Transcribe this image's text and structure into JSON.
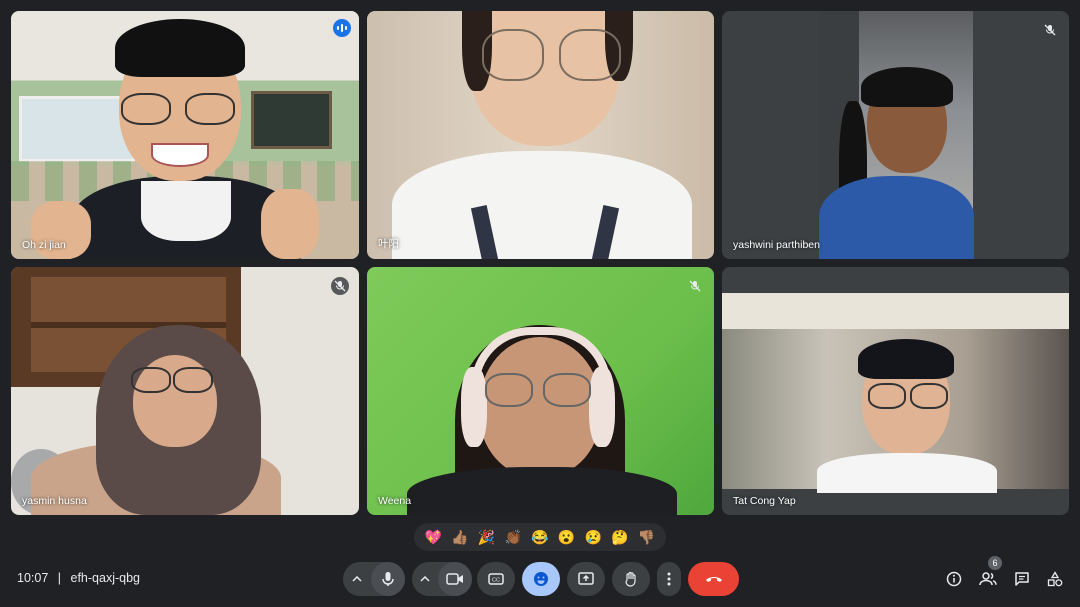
{
  "meeting": {
    "time": "10:07",
    "separator": "|",
    "code": "efh-qaxj-qbg"
  },
  "participants": [
    {
      "name": "Oh zi jian",
      "muted": false,
      "speaking": true
    },
    {
      "name": "叶阳",
      "muted": false,
      "speaking": false
    },
    {
      "name": "yashwini parthiben",
      "muted": true,
      "speaking": false
    },
    {
      "name": "yasmin husna",
      "muted": true,
      "speaking": false
    },
    {
      "name": "Weena",
      "muted": true,
      "speaking": false
    },
    {
      "name": "Tat Cong Yap",
      "muted": false,
      "speaking": false
    }
  ],
  "reactions": [
    "💖",
    "👍🏽",
    "🎉",
    "👏🏾",
    "😂",
    "😮",
    "😢",
    "🤔",
    "👎🏽"
  ],
  "controls": {
    "participant_count": "6"
  },
  "colors": {
    "background": "#202124",
    "control": "#3c4043",
    "active_blue": "#8ab4f8",
    "end_call": "#ea4335",
    "emoji_active": "#a8c7fa"
  }
}
